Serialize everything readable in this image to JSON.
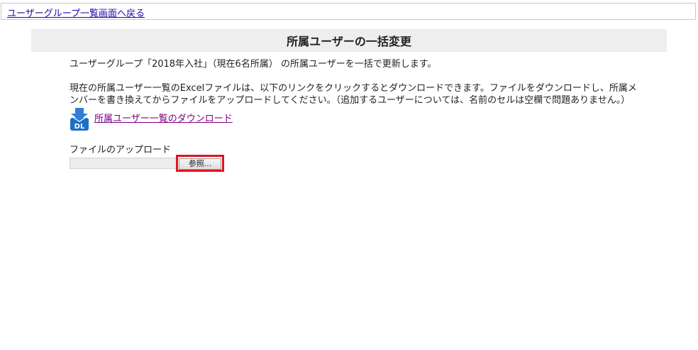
{
  "nav": {
    "back_link": "ユーザーグループ一覧画面へ戻る"
  },
  "header": {
    "title": "所属ユーザーの一括変更"
  },
  "main": {
    "intro": "ユーザーグループ「2018年入社」（現在6名所属） の所属ユーザーを一括で更新します。",
    "instructions": "現在の所属ユーザー一覧のExcelファイルは、以下のリンクをクリックするとダウンロードできます。ファイルをダウンロードし、所属メンバーを書き換えてからファイルをアップロードしてください。（追加するユーザーについては、名前のセルは空欄で問題ありません。）",
    "download_icon_label": "DL",
    "download_link": "所属ユーザー一覧のダウンロード",
    "upload_label": "ファイルのアップロード",
    "browse_button": "参照..."
  },
  "icons": {
    "download": "download-icon"
  },
  "colors": {
    "title_band": "#eeeeee",
    "link": "#1a0dab",
    "visited_link": "#800080",
    "icon_blue": "#1f6fc4",
    "highlight": "#e2141f"
  }
}
